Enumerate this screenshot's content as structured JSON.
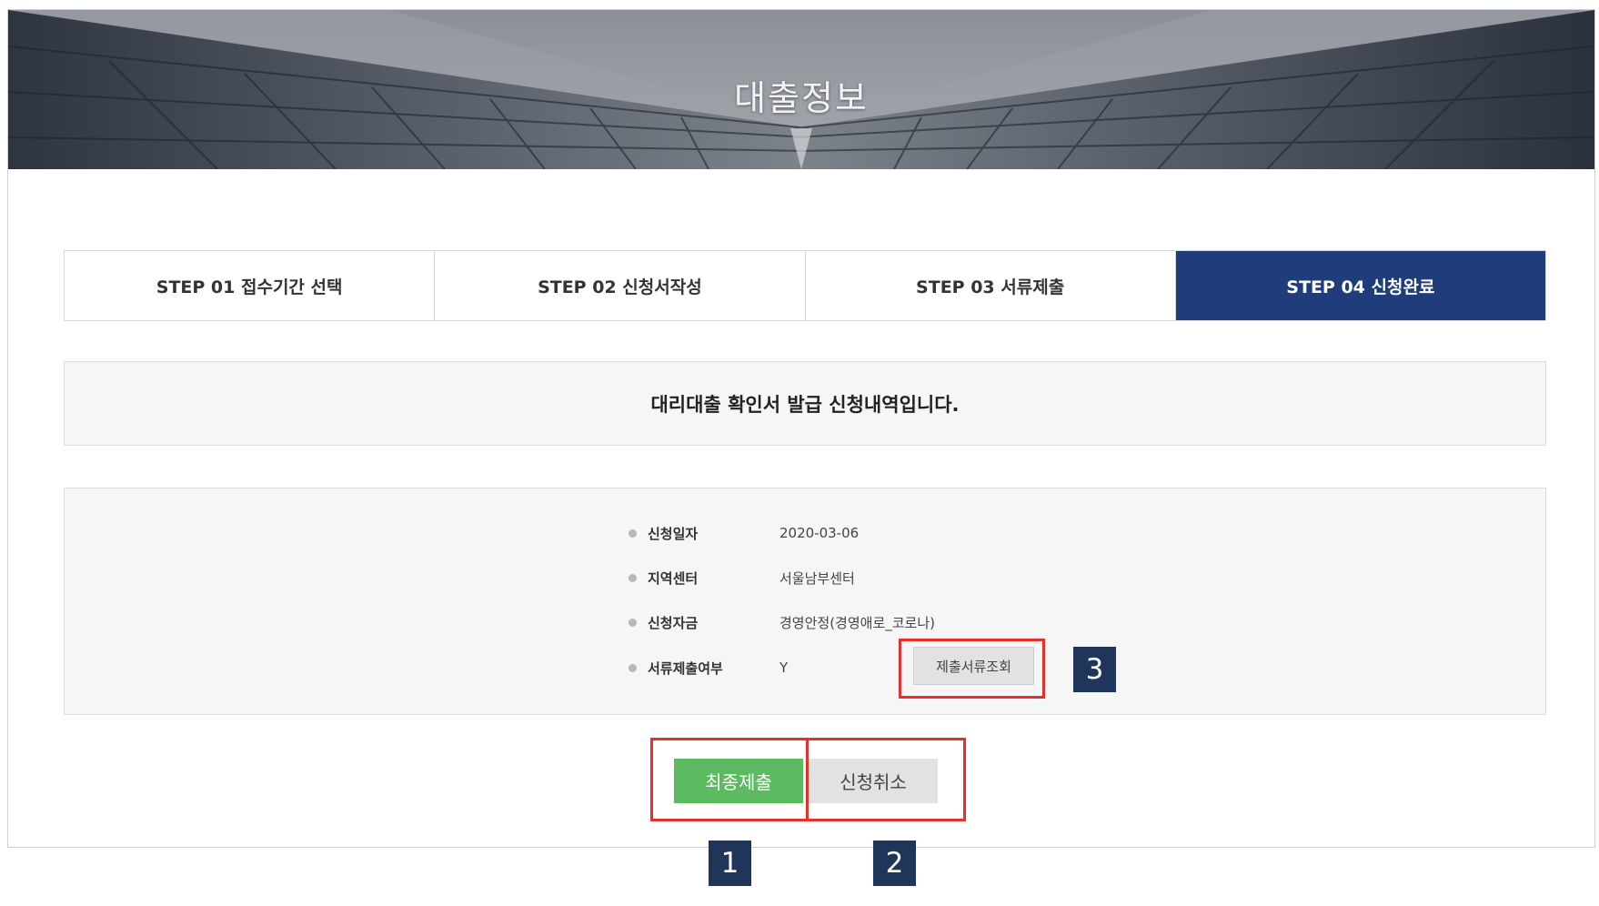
{
  "header": {
    "title": "대출정보"
  },
  "steps": [
    {
      "label": "STEP 01 접수기간 선택",
      "active": false
    },
    {
      "label": "STEP 02 신청서작성",
      "active": false
    },
    {
      "label": "STEP 03 서류제출",
      "active": false
    },
    {
      "label": "STEP 04 신청완료",
      "active": true
    }
  ],
  "notice": {
    "text": "대리대출 확인서 발급 신청내역입니다."
  },
  "details": [
    {
      "label": "신청일자",
      "value": "2020-03-06"
    },
    {
      "label": "지역센터",
      "value": "서울남부센터"
    },
    {
      "label": "신청자금",
      "value": "경영안정(경영애로_코로나)"
    },
    {
      "label": "서류제출여부",
      "value": "Y"
    }
  ],
  "buttons": {
    "view_documents": "제출서류조회",
    "final_submit": "최종제출",
    "cancel_application": "신청취소"
  },
  "markers": [
    "1",
    "2",
    "3"
  ],
  "colors": {
    "active_step": "#1f3d7a",
    "submit_button": "#5cba61",
    "highlight": "#e3322b",
    "marker": "#1f3559"
  }
}
